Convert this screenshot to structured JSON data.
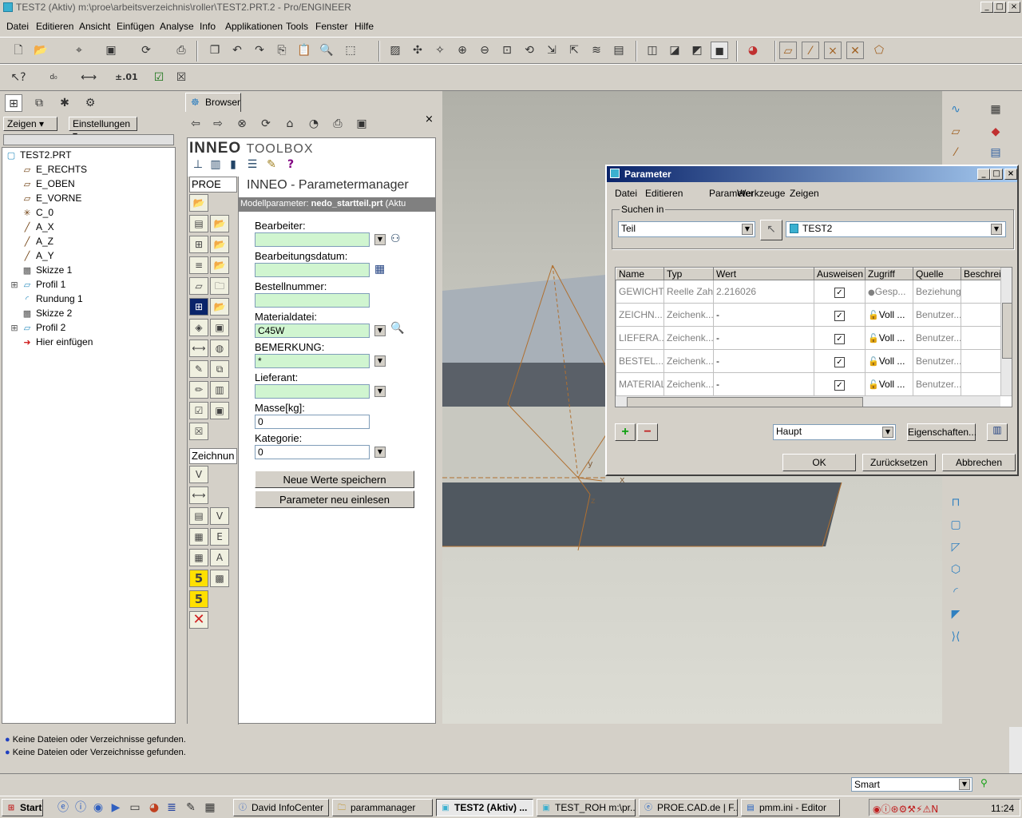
{
  "window": {
    "title": "TEST2 (Aktiv) m:\\proe\\arbeitsverzeichnis\\roller\\TEST2.PRT.2 - Pro/ENGINEER",
    "min": "_",
    "max": "□",
    "close": "×"
  },
  "menu": [
    "Datei",
    "Editieren",
    "Ansicht",
    "Einfügen",
    "Analyse",
    "Info",
    "Applikationen",
    "Tools",
    "Fenster",
    "Hilfe"
  ],
  "tree": {
    "show_label": "Zeigen",
    "settings_label": "Einstellungen",
    "root": "TEST2.PRT",
    "items": [
      "E_RECHTS",
      "E_OBEN",
      "E_VORNE",
      "C_0",
      "A_X",
      "A_Z",
      "A_Y",
      "Skizze 1",
      "Profil 1",
      "Rundung 1",
      "Skizze 2",
      "Profil 2",
      "Hier einfügen"
    ]
  },
  "browser": {
    "tab_label": "Browser",
    "close": "×",
    "brand": "INNEO",
    "brand_sub": "TOOLBOX",
    "proe_tab": "PROE",
    "zeichnung_tab": "Zeichnun",
    "pm_title": "INNEO - Parametermanager",
    "model_label": "Modellparameter:",
    "model_file": "nedo_startteil.prt",
    "model_suffix": "(Aktu",
    "fields": {
      "bearbeiter_label": "Bearbeiter:",
      "bearbeiter_value": "",
      "datum_label": "Bearbeitungsdatum:",
      "datum_value": "",
      "bestellnr_label": "Bestellnummer:",
      "bestellnr_value": "",
      "material_label": "Materialdatei:",
      "material_value": "C45W",
      "bemerkung_label": "BEMERKUNG:",
      "bemerkung_value": "*",
      "lieferant_label": "Lieferant:",
      "lieferant_value": "",
      "masse_label": "Masse[kg]:",
      "masse_value": "0",
      "kategorie_label": "Kategorie:",
      "kategorie_value": "0"
    },
    "save_btn": "Neue Werte speichern",
    "reload_btn": "Parameter neu einlesen",
    "icon_5a": "5",
    "icon_5b": "5"
  },
  "dialog": {
    "title": "Parameter",
    "menu": [
      "Datei",
      "Editieren",
      "Parameter",
      "Werkzeuge",
      "Zeigen"
    ],
    "search_group": "Suchen in",
    "search_type": "Teil",
    "search_target": "TEST2",
    "columns": [
      "Name",
      "Typ",
      "Wert",
      "Ausweisen",
      "Zugriff",
      "Quelle",
      "Beschreibun"
    ],
    "rows": [
      {
        "name": "GEWICHT",
        "typ": "Reelle Zahl",
        "wert": "2.216026",
        "ausweisen": "✓",
        "zugriff": "Gesp...",
        "quelle": "Beziehung"
      },
      {
        "name": "ZEICHN...",
        "typ": "Zeichenk...",
        "wert": "-",
        "ausweisen": "✓",
        "zugriff": "Voll",
        "quelle": "Benutzer..."
      },
      {
        "name": "LIEFERA...",
        "typ": "Zeichenk...",
        "wert": "-",
        "ausweisen": "✓",
        "zugriff": "Voll",
        "quelle": "Benutzer..."
      },
      {
        "name": "BESTEL...",
        "typ": "Zeichenk...",
        "wert": "-",
        "ausweisen": "✓",
        "zugriff": "Voll",
        "quelle": "Benutzer..."
      },
      {
        "name": "MATERIAL",
        "typ": "Zeichenk...",
        "wert": "-",
        "ausweisen": "✓",
        "zugriff": "Voll",
        "quelle": "Benutzer..."
      }
    ],
    "ellipsis": "...",
    "filter": "Haupt",
    "props_btn": "Eigenschaften...",
    "ok_btn": "OK",
    "reset_btn": "Zurücksetzen",
    "cancel_btn": "Abbrechen"
  },
  "messages": [
    "Keine Dateien oder Verzeichnisse gefunden.",
    "Keine Dateien oder Verzeichnisse gefunden."
  ],
  "status": {
    "filter": "Smart"
  },
  "viewport": {
    "axis_y": "y",
    "axis_x": "x",
    "axis_z": "z"
  },
  "taskbar": {
    "start": "Start",
    "tasks": [
      "David InfoCenter",
      "parammanager",
      "TEST2 (Aktiv) ...",
      "TEST_ROH m:\\pr...",
      "PROE.CAD.de | F...",
      "pmm.ini - Editor"
    ],
    "clock": "11:24"
  }
}
